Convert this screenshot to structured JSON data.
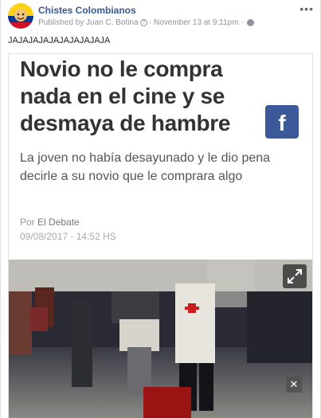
{
  "post": {
    "page_name": "Chistes Colombianos",
    "published_by": "Published by Juan C. Botina",
    "help": "?",
    "separator": "·",
    "timestamp": "November 13 at 9:11pm",
    "separator2": "·",
    "more": "•••",
    "text": "JAJAJAJAJAJAJAJAJAJA"
  },
  "article": {
    "headline": "Novio no le compra nada en el cine y se desmaya de hambre",
    "fb_badge": "f",
    "subhead": "La joven no había desayunado y le dio pena decirle a su novio que le comprara algo",
    "by_prefix": "Por",
    "source": "El Debate",
    "date": "09/08/2017 - 14:52 HS",
    "close": "✕"
  },
  "colors": {
    "link": "#365899",
    "facebook_blue": "#3b5998",
    "meta_gray": "#90949c"
  },
  "icons": {
    "more": "more-icon",
    "globe": "globe-icon",
    "expand": "expand-icon",
    "close": "close-icon"
  }
}
